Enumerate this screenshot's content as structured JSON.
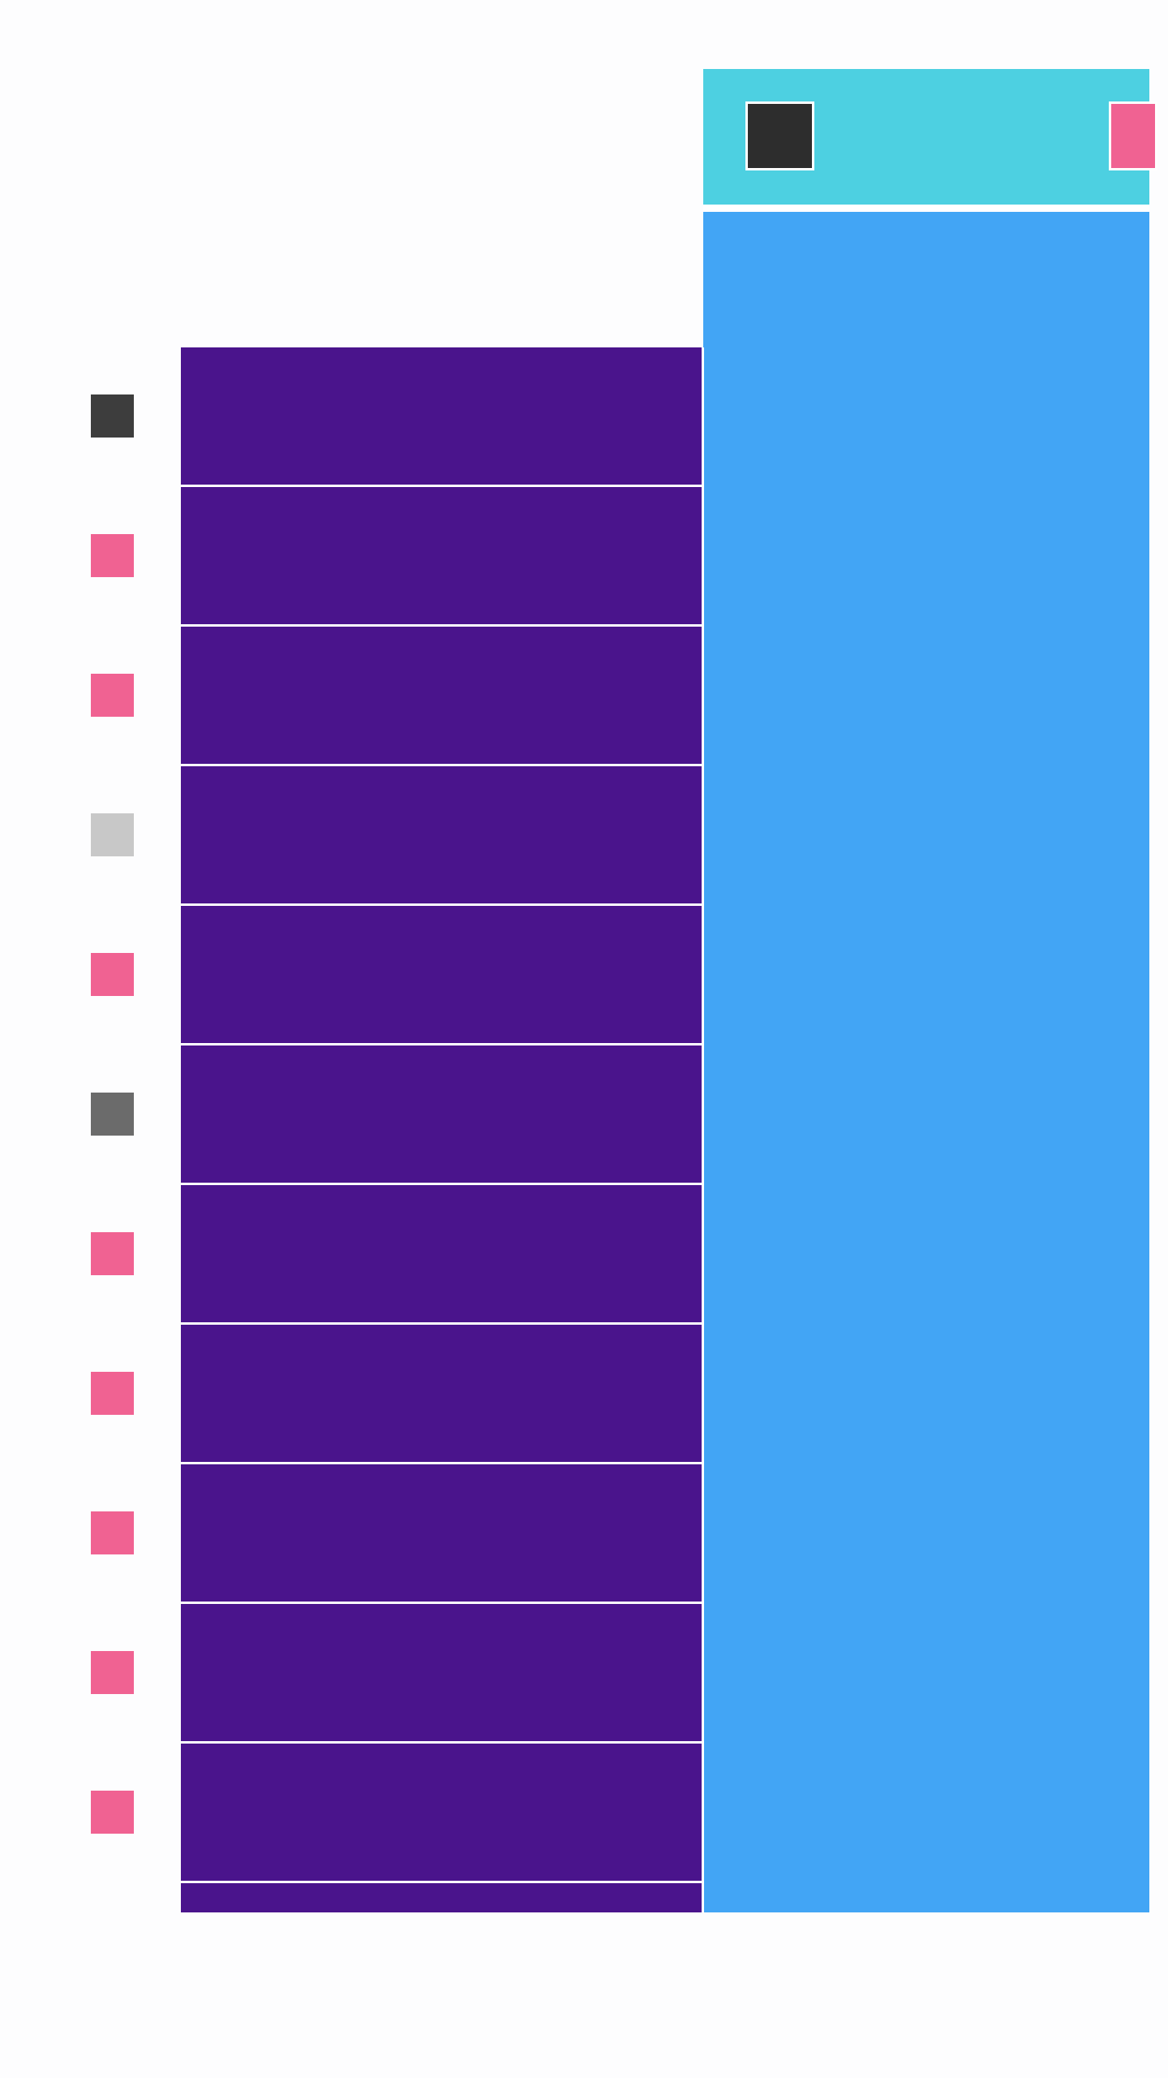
{
  "colors": {
    "background": "#fdfdfe",
    "header": "#4dd0e1",
    "panel": "#42a5f5",
    "row": "#4a148c",
    "separator": "#ffffff"
  },
  "header": {
    "left_button_color": "#2d2d2d",
    "right_button_color": "#f06292"
  },
  "rows": [
    {
      "swatch": "#3d3d3d"
    },
    {
      "swatch": "#f06292"
    },
    {
      "swatch": "#f06292"
    },
    {
      "swatch": "#c8c8c8"
    },
    {
      "swatch": "#f06292"
    },
    {
      "swatch": "#6b6b6b"
    },
    {
      "swatch": "#f06292"
    },
    {
      "swatch": "#f06292"
    },
    {
      "swatch": "#f06292"
    },
    {
      "swatch": "#f06292"
    },
    {
      "swatch": "#f06292"
    },
    {
      "swatch": null
    }
  ]
}
